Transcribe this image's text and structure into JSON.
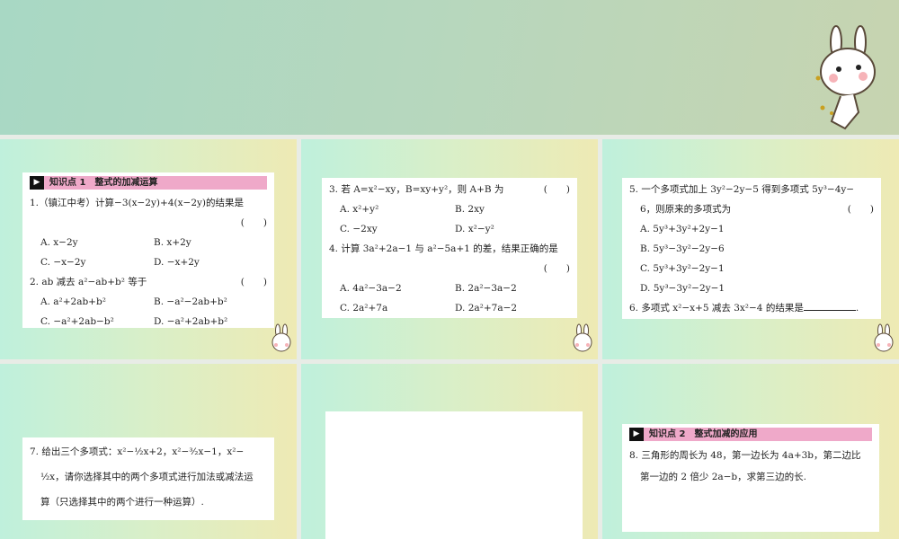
{
  "slide1": {
    "section": "知识点 1　整式的加减运算",
    "q1": "1.（镇江中考）计算−3(x−2y)+4(x−2y)的结果是",
    "paren": "(　　)",
    "q1_opts": [
      "A. x−2y",
      "B. x+2y",
      "C. −x−2y",
      "D. −x+2y"
    ],
    "q2": "2. ab 减去 a²−ab+b² 等于",
    "q2_opts": [
      "A. a²+2ab+b²",
      "B. −a²−2ab+b²",
      "C. −a²+2ab−b²",
      "D. −a²+2ab+b²"
    ]
  },
  "slide2": {
    "q3": "3. 若 A=x²−xy，B=xy+y²，则 A+B 为",
    "paren": "(　　)",
    "q3_opts": [
      "A. x²+y²",
      "B. 2xy",
      "C. −2xy",
      "D. x²−y²"
    ],
    "q4": "4. 计算 3a²+2a−1 与 a²−5a+1 的差，结果正确的是",
    "q4_opts": [
      "A. 4a²−3a−2",
      "B. 2a²−3a−2",
      "C. 2a²+7a",
      "D. 2a²+7a−2"
    ]
  },
  "slide3": {
    "q5_line1": "5. 一个多项式加上 3y²−2y−5 得到多项式 5y³−4y−",
    "q5_line2": "6，则原来的多项式为",
    "paren": "(　　)",
    "q5_opts": [
      "A. 5y³+3y²+2y−1",
      "B. 5y³−3y²−2y−6",
      "C. 5y³+3y²−2y−1",
      "D. 5y³−3y²−2y−1"
    ],
    "q6": "6. 多项式 x²−x+5 减去 3x²−4 的结果是",
    "q6_end": "."
  },
  "slide4": {
    "q7_line1": "7. 给出三个多项式：x²−½x+2，x²−³⁄₂x−1，x²−",
    "q7_line2": "½x，请你选择其中的两个多项式进行加法或减法运",
    "q7_line3": "算（只选择其中的两个进行一种运算）."
  },
  "slide6": {
    "section": "知识点 2　整式加减的应用",
    "q8_line1": "8. 三角形的周长为 48，第一边长为 4a+3b，第二边比",
    "q8_line2": "第一边的 2 倍少 2a−b，求第三边的长."
  }
}
